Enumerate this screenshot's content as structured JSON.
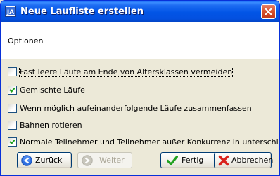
{
  "window": {
    "title": "Neue Laufliste erstellen"
  },
  "header": {
    "text": "Optionen"
  },
  "options": [
    {
      "label": "Fast leere Läufe am Ende von Altersklassen vermeiden",
      "checked": false
    },
    {
      "label": "Gemischte Läufe",
      "checked": true
    },
    {
      "label": "Wenn möglich aufeinanderfolgende Läufe zusammenfassen",
      "checked": false
    },
    {
      "label": "Bahnen rotieren",
      "checked": false
    },
    {
      "label": "Normale Teilnehmer und Teilnehmer außer Konkurrenz in unterschiedlichen Lä",
      "checked": true
    }
  ],
  "buttons": {
    "back": "Zurück",
    "next": "Weiter",
    "finish": "Fertig",
    "cancel": "Abbrechen"
  },
  "colors": {
    "check": "#21a121",
    "title_bar": "#0255e6",
    "close": "#d8532f"
  }
}
